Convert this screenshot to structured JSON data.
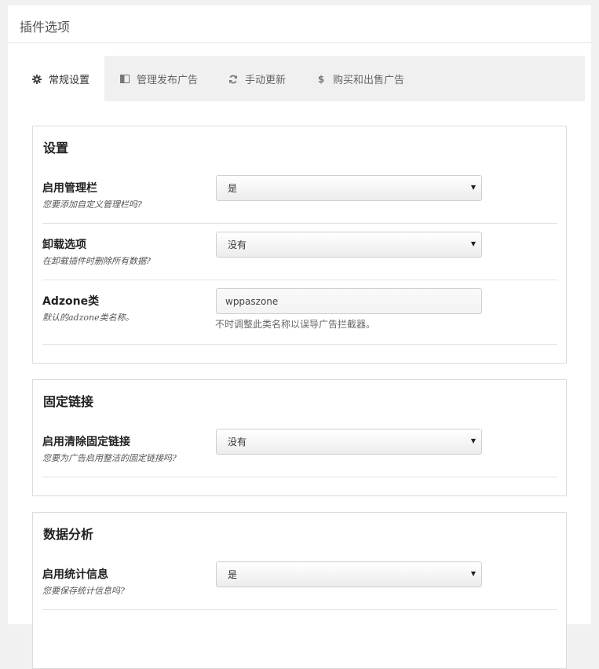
{
  "header": {
    "title": "插件选项"
  },
  "tabs": [
    {
      "label": "常规设置",
      "icon": "gear-icon"
    },
    {
      "label": "管理发布广告",
      "icon": "columns-icon"
    },
    {
      "label": "手动更新",
      "icon": "refresh-icon"
    },
    {
      "label": "购买和出售广告",
      "icon": "dollar-icon"
    }
  ],
  "sections": {
    "settings": {
      "title": "设置",
      "admin_bar": {
        "label": "启用管理栏",
        "desc": "您要添加自定义管理栏吗?",
        "value": "是"
      },
      "uninstall": {
        "label": "卸载选项",
        "desc": "在卸载插件时删除所有数据?",
        "value": "没有"
      },
      "adzone_class": {
        "label": "Adzone类",
        "desc": "默认的adzone类名称。",
        "value": "wppaszone",
        "help": "不时调整此类名称以误导广告拦截器。"
      }
    },
    "permalinks": {
      "title": "固定链接",
      "clean": {
        "label": "启用清除固定链接",
        "desc": "您要为广告启用整洁的固定链接吗?",
        "value": "没有"
      }
    },
    "analytics": {
      "title": "数据分析",
      "stats": {
        "label": "启用统计信息",
        "desc": "您要保存统计信息吗?",
        "value": "是"
      }
    }
  }
}
